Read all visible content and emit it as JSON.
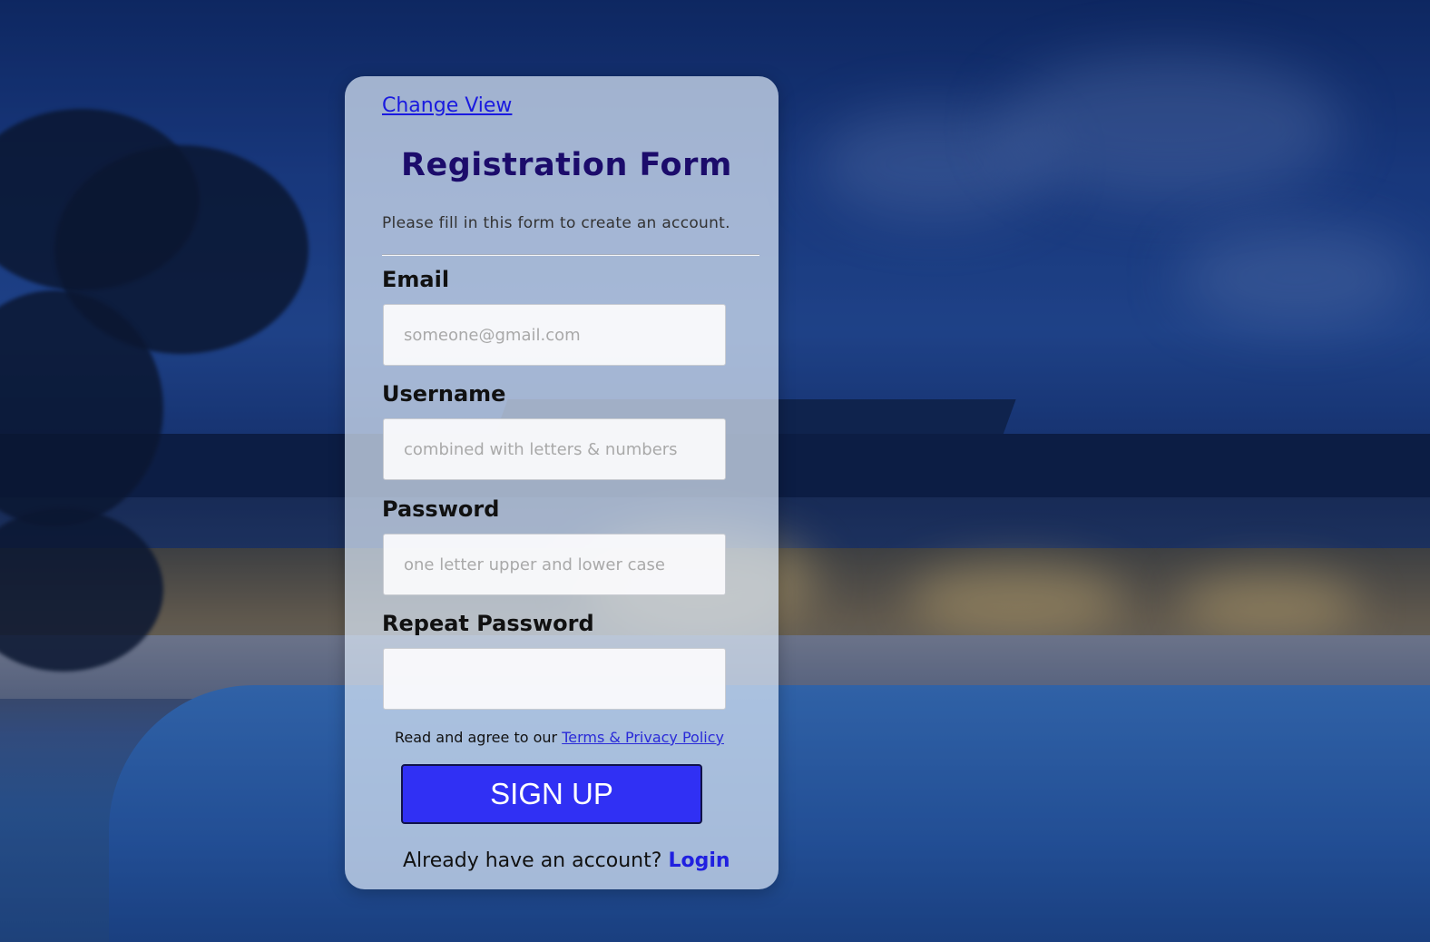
{
  "form": {
    "change_view": "Change View",
    "title": "Registration Form",
    "subtitle": "Please fill in this form to create an account.",
    "email_label": "Email",
    "email_placeholder": "someone@gmail.com",
    "username_label": "Username",
    "username_placeholder": "combined with letters & numbers",
    "password_label": "Password",
    "password_placeholder": "one letter upper and lower case",
    "repeat_label": "Repeat Password",
    "repeat_placeholder": "",
    "terms_prefix": "Read and agree to our",
    "terms_link": "Terms & Privacy Policy",
    "signup_label": "SIGN UP",
    "login_prefix": "Already have an account?",
    "login_link": "Login"
  },
  "colors": {
    "title": "#1c0c6b",
    "link": "#1a1adf",
    "button": "#3030f4"
  }
}
